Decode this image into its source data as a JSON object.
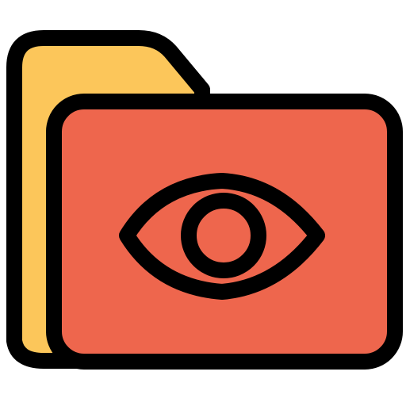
{
  "icon": {
    "name": "folder-eye-icon",
    "colors": {
      "background": "#ffffff",
      "outline": "#000000",
      "folder_back": "#fcc65a",
      "folder_front": "#ee664d"
    }
  }
}
